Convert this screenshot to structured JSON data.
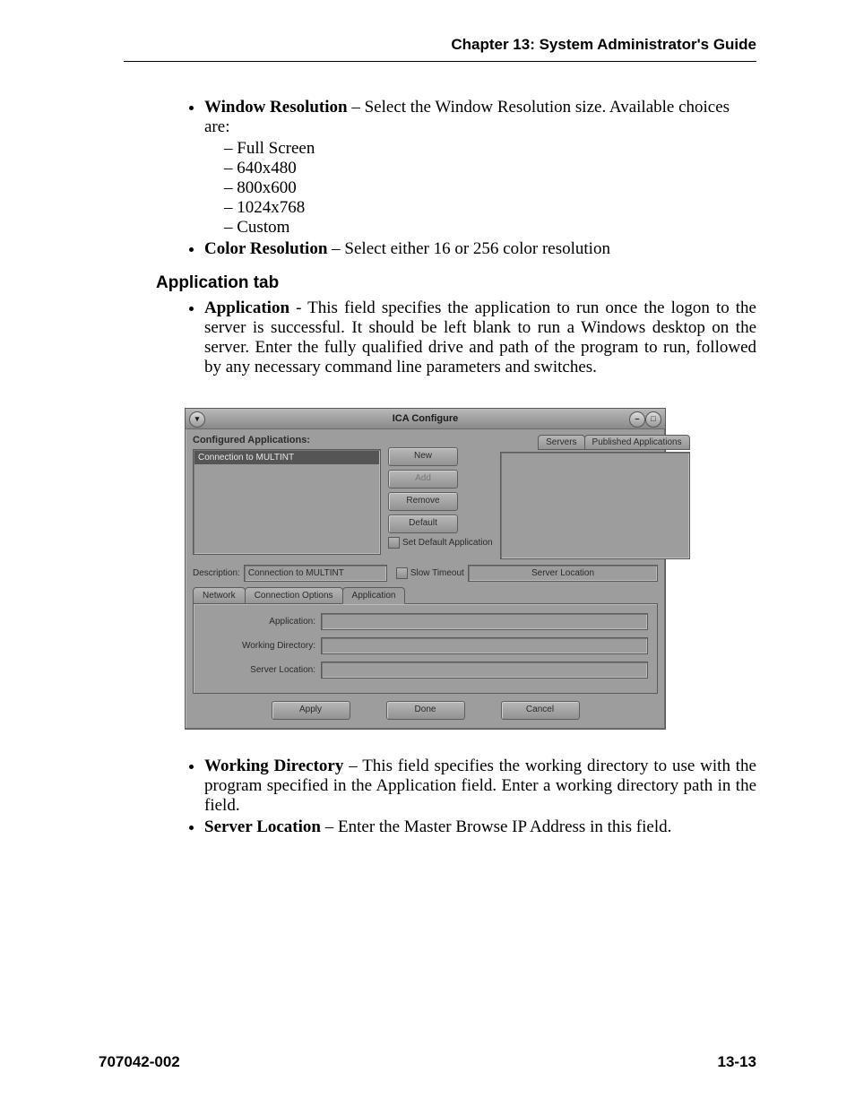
{
  "header": {
    "chapter": "Chapter 13: System Administrator's Guide"
  },
  "body": {
    "window_res_label": "Window Resolution",
    "window_res_text": " – Select the Window Resolution size. Available choices are:",
    "resolutions": [
      "Full Screen",
      "640x480",
      "800x600",
      "1024x768",
      "Custom"
    ],
    "color_res_label": "Color Resolution",
    "color_res_text": " – Select either 16 or 256 color resolution",
    "section_heading": "Application tab",
    "application_label": "Application",
    "application_text": " - This field specifies the application to run once the logon to the server is successful. It should be left blank to run a Windows desktop on the server. Enter the fully qualified drive and path of the program to run, followed by any necessary command line parameters and switches.",
    "working_dir_label": "Working Directory",
    "working_dir_text": " – This field specifies the working directory to use with the program specified in the Application field. Enter a working directory path in the field.",
    "server_loc_label": "Server Location",
    "server_loc_text": " – Enter the Master Browse IP Address in this field."
  },
  "window": {
    "title": "ICA Configure",
    "configured_label": "Configured Applications:",
    "list_selected": "Connection to MULTINT",
    "buttons": {
      "new": "New",
      "add": "Add",
      "remove": "Remove",
      "default": "Default",
      "set_default": "Set Default Application"
    },
    "right_tabs": {
      "servers": "Servers",
      "published": "Published Applications"
    },
    "desc_label": "Description:",
    "desc_value": "Connection to MULTINT",
    "slow_timeout": "Slow Timeout",
    "server_location": "Server Location",
    "inner_tabs": {
      "network": "Network",
      "conn_opts": "Connection Options",
      "application": "Application"
    },
    "form": {
      "application": "Application:",
      "working_dir": "Working Directory:",
      "server_loc": "Server Location:"
    },
    "dlg_buttons": {
      "apply": "Apply",
      "done": "Done",
      "cancel": "Cancel"
    }
  },
  "footer": {
    "left": "707042-002",
    "right": "13-13"
  }
}
